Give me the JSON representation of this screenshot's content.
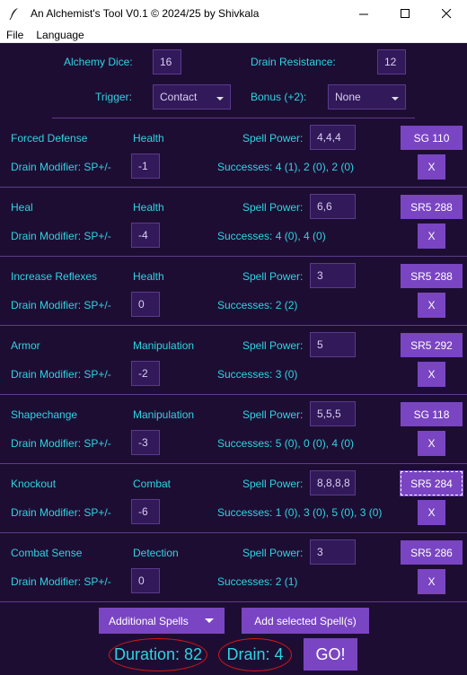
{
  "window": {
    "title": "An Alchemist's Tool V0.1    © 2024/25 by Shivkala"
  },
  "menu": [
    "File",
    "Language"
  ],
  "settings": {
    "dice_label": "Alchemy Dice:",
    "dice_value": "16",
    "drain_res_label": "Drain Resistance:",
    "drain_res_value": "12",
    "trigger_label": "Trigger:",
    "trigger_value": "Contact",
    "bonus_label": "Bonus (+2):",
    "bonus_value": "None"
  },
  "spell_power_label": "Spell Power:",
  "drain_mod_label": "Drain Modifier: SP+/-",
  "remove_label": "X",
  "spells": [
    {
      "name": "Forced Defense",
      "category": "Health",
      "power": "4,4,4",
      "source": "SG 110",
      "drain_mod": "-1",
      "successes": "Successes: 4 (1), 2 (0), 2 (0)"
    },
    {
      "name": "Heal",
      "category": "Health",
      "power": "6,6",
      "source": "SR5 288",
      "drain_mod": "-4",
      "successes": "Successes: 4 (0), 4 (0)"
    },
    {
      "name": "Increase Reflexes",
      "category": "Health",
      "power": "3",
      "source": "SR5 288",
      "drain_mod": "0",
      "successes": "Successes: 2 (2)"
    },
    {
      "name": "Armor",
      "category": "Manipulation",
      "power": "5",
      "source": "SR5 292",
      "drain_mod": "-2",
      "successes": "Successes: 3 (0)"
    },
    {
      "name": "Shapechange",
      "category": "Manipulation",
      "power": "5,5,5",
      "source": "SG 118",
      "drain_mod": "-3",
      "successes": "Successes: 5 (0), 0 (0), 4 (0)"
    },
    {
      "name": "Knockout",
      "category": "Combat",
      "power": "8,8,8,8",
      "source": "SR5 284",
      "drain_mod": "-6",
      "successes": "Successes: 1 (0), 3 (0), 5 (0), 3 (0)"
    },
    {
      "name": "Combat Sense",
      "category": "Detection",
      "power": "3",
      "source": "SR5 286",
      "drain_mod": "0",
      "successes": "Successes: 2 (1)"
    }
  ],
  "footer": {
    "additional_spells": "Additional Spells",
    "add_selected": "Add selected Spell(s)",
    "duration": "Duration: 82",
    "drain": "Drain: 4",
    "go": "GO!"
  },
  "colors": {
    "background": "#1e0d33",
    "text": "#2fd3e0",
    "button": "#7a45c2",
    "field": "#32195a",
    "highlight_ellipse": "#d01818"
  }
}
